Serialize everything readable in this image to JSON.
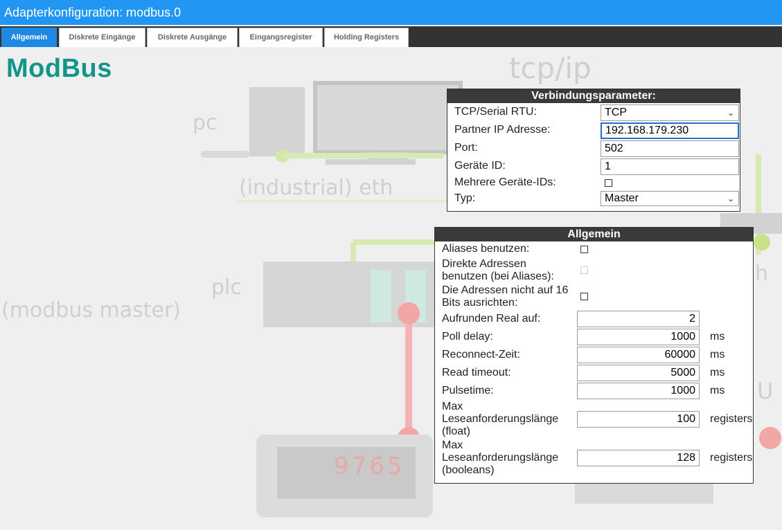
{
  "window": {
    "title": "Adapterkonfiguration: modbus.0"
  },
  "tabs": [
    {
      "label": "Allgemein",
      "active": true
    },
    {
      "label": "Diskrete Eingänge",
      "active": false
    },
    {
      "label": "Diskrete Ausgänge",
      "active": false
    },
    {
      "label": "Eingangsregister",
      "active": false
    },
    {
      "label": "Holding Registers",
      "active": false
    }
  ],
  "page": {
    "heading": "ModBus"
  },
  "background": {
    "tcpip": "tcp/ip",
    "pc": "pc",
    "ethernet": "(industrial) eth",
    "plc": "plc",
    "plc_sub": "(modbus master)",
    "right_h": "h",
    "right_u": "U",
    "display_digits": "9765"
  },
  "connection": {
    "title": "Verbindungsparameter:",
    "protocol_label": "TCP/Serial RTU:",
    "protocol_value": "TCP",
    "ip_label": "Partner IP Adresse:",
    "ip_value": "192.168.179.230",
    "port_label": "Port:",
    "port_value": "502",
    "device_id_label": "Geräte ID:",
    "device_id_value": "1",
    "multi_ids_label": "Mehrere Geräte-IDs:",
    "type_label": "Typ:",
    "type_value": "Master"
  },
  "general": {
    "title": "Allgemein",
    "aliases_label": "Aliases benutzen:",
    "direct_addr_label_1": "Direkte Adressen",
    "direct_addr_label_2": "benutzen (bei Aliases):",
    "no_align_label_1": "Die Adressen nicht auf 16",
    "no_align_label_2": "Bits ausrichten:",
    "round_label": "Aufrunden Real auf:",
    "round_value": "2",
    "poll_label": "Poll delay:",
    "poll_value": "1000",
    "poll_unit": "ms",
    "reconnect_label": "Reconnect-Zeit:",
    "reconnect_value": "60000",
    "reconnect_unit": "ms",
    "timeout_label": "Read timeout:",
    "timeout_value": "5000",
    "timeout_unit": "ms",
    "pulse_label": "Pulsetime:",
    "pulse_value": "1000",
    "pulse_unit": "ms",
    "maxfloat_label_1": "Max",
    "maxfloat_label_2": "Leseanforderungslänge",
    "maxfloat_label_3": "(float)",
    "maxfloat_value": "100",
    "maxfloat_unit": "registers",
    "maxbool_label_1": "Max",
    "maxbool_label_2": "Leseanforderungslänge",
    "maxbool_label_3": "(booleans)",
    "maxbool_value": "128",
    "maxbool_unit": "registers"
  }
}
